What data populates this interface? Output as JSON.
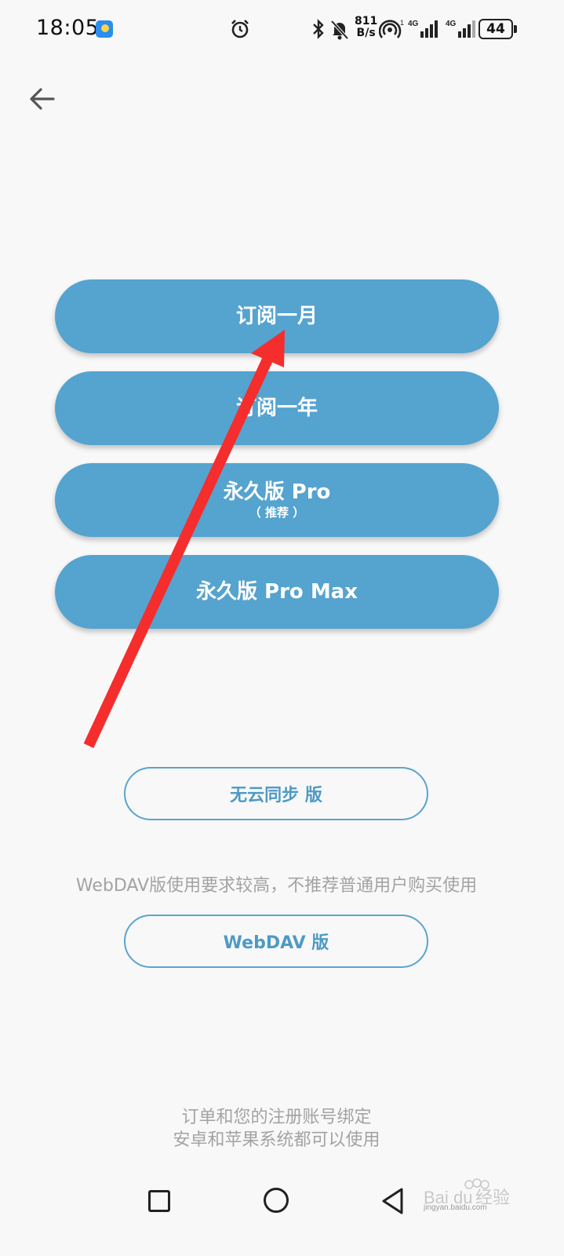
{
  "status_bar": {
    "time": "18:05",
    "net_speed_value": "811",
    "net_speed_unit": "B/s",
    "signal_1_label": "4G",
    "signal_2_label": "4G",
    "battery": "44"
  },
  "plans": [
    {
      "label": "订阅一月",
      "sub": ""
    },
    {
      "label": "订阅一年",
      "sub": ""
    },
    {
      "label": "永久版 Pro",
      "sub": "（ 推荐 ）"
    },
    {
      "label": "永久版 Pro Max",
      "sub": ""
    }
  ],
  "no_cloud_button": "无云同步 版",
  "webdav_note": "WebDAV版使用要求较高，不推荐普通用户购买使用",
  "webdav_button": "WebDAV 版",
  "footer": {
    "line1": "订单和您的注册账号绑定",
    "line2": "安卓和苹果系统都可以使用"
  },
  "colors": {
    "plan_button": "#55a3cf",
    "outline_button": "#5aa4cf",
    "annotation_arrow": "#f52d2d",
    "background": "#f8f8f8"
  },
  "icons": {
    "back": "arrow-left-icon",
    "nav_recents": "square-icon",
    "nav_home": "circle-icon",
    "nav_back": "triangle-back-icon"
  },
  "watermark": {
    "logo": "Baidu经验",
    "url": "jingyan.baidu.com"
  }
}
